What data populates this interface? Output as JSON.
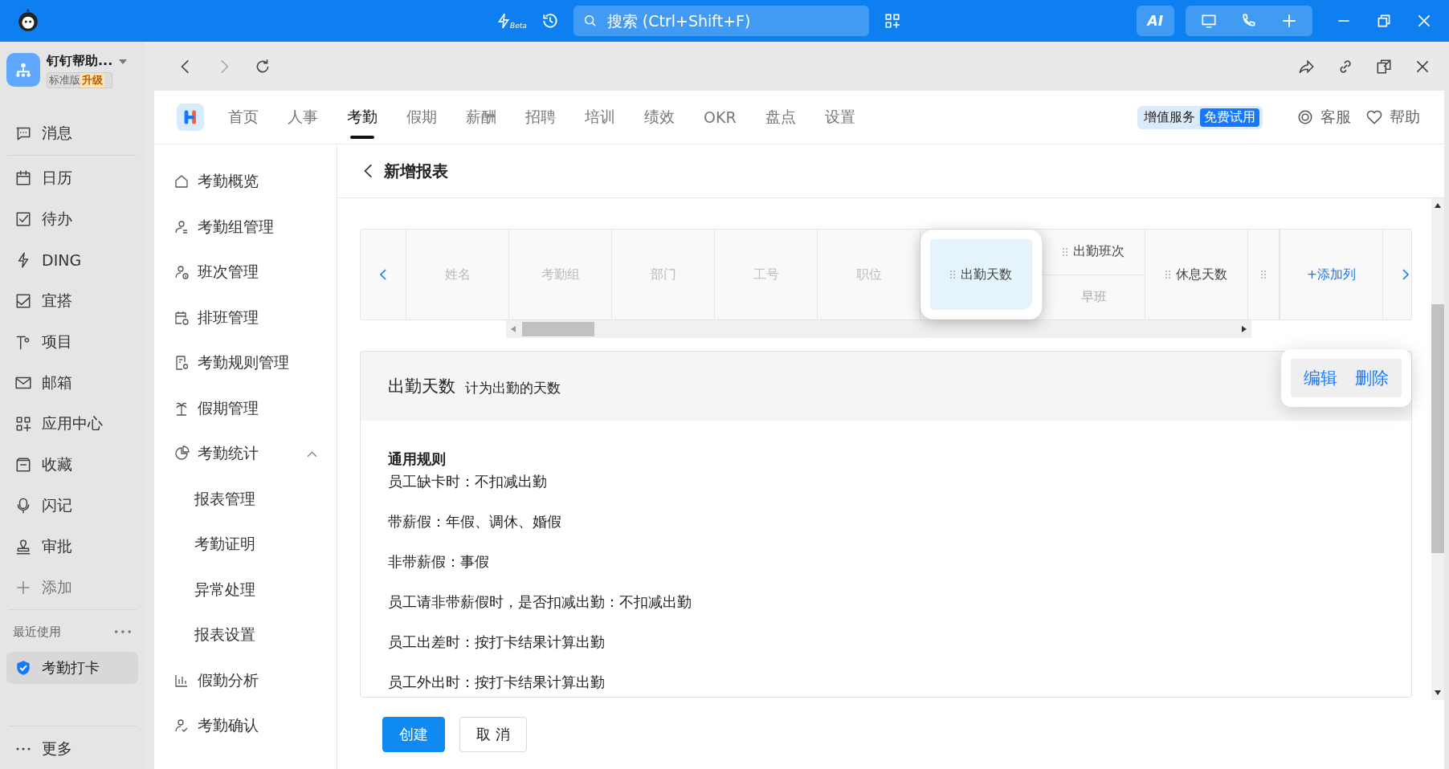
{
  "titlebar": {
    "beta_label": "Beta",
    "search_placeholder": "搜索 (Ctrl+Shift+F)",
    "ai_label": "AI"
  },
  "org": {
    "name": "钉钉帮助...",
    "edition": "标准版",
    "upgrade": "升级"
  },
  "sidebar": {
    "items": [
      {
        "label": "消息",
        "kind": "nav"
      },
      {
        "label": "日历",
        "kind": "nav"
      },
      {
        "label": "待办",
        "kind": "nav"
      },
      {
        "label": "DING",
        "kind": "nav"
      },
      {
        "label": "宜搭",
        "kind": "nav"
      },
      {
        "label": "项目",
        "kind": "nav"
      },
      {
        "label": "邮箱",
        "kind": "nav"
      },
      {
        "label": "应用中心",
        "kind": "nav"
      },
      {
        "label": "收藏",
        "kind": "nav"
      },
      {
        "label": "闪记",
        "kind": "nav"
      },
      {
        "label": "审批",
        "kind": "nav"
      },
      {
        "label": "添加",
        "kind": "add"
      }
    ],
    "recent_label": "最近使用",
    "recent": [
      {
        "label": "考勤打卡",
        "selected": true
      }
    ],
    "more": "更多"
  },
  "app_nav": {
    "tabs": [
      {
        "label": "首页",
        "selected": false
      },
      {
        "label": "人事",
        "selected": false
      },
      {
        "label": "考勤",
        "selected": true
      },
      {
        "label": "假期",
        "selected": false
      },
      {
        "label": "薪酬",
        "selected": false
      },
      {
        "label": "招聘",
        "selected": false
      },
      {
        "label": "培训",
        "selected": false
      },
      {
        "label": "绩效",
        "selected": false
      },
      {
        "label": "OKR",
        "selected": false
      },
      {
        "label": "盘点",
        "selected": false
      },
      {
        "label": "设置",
        "selected": false
      }
    ],
    "value_service": "增值服务",
    "free_trial": "免费试用",
    "support": "客服",
    "help": "帮助"
  },
  "menu": [
    {
      "label": "考勤概览"
    },
    {
      "label": "考勤组管理"
    },
    {
      "label": "班次管理"
    },
    {
      "label": "排班管理"
    },
    {
      "label": "考勤规则管理"
    },
    {
      "label": "假期管理"
    },
    {
      "label": "考勤统计",
      "expanded": true,
      "children": [
        {
          "label": "报表管理"
        },
        {
          "label": "考勤证明"
        },
        {
          "label": "异常处理"
        },
        {
          "label": "报表设置"
        }
      ]
    },
    {
      "label": "假勤分析"
    },
    {
      "label": "考勤确认"
    }
  ],
  "page_title": "新增报表",
  "columns": [
    {
      "label": "姓名",
      "kind": "fixed",
      "selected": false
    },
    {
      "label": "考勤组",
      "kind": "fixed",
      "selected": false
    },
    {
      "label": "部门",
      "kind": "fixed",
      "selected": false
    },
    {
      "label": "工号",
      "kind": "fixed",
      "selected": false
    },
    {
      "label": "职位",
      "kind": "fixed",
      "selected": false
    },
    {
      "label": "出勤天数",
      "kind": "custom",
      "selected": true
    },
    {
      "label": "出勤班次",
      "kind": "custom",
      "selected": false,
      "sub": "早班"
    },
    {
      "label": "休息天数",
      "kind": "custom",
      "selected": false
    },
    {
      "kind": "cut"
    }
  ],
  "add_column": "+添加列",
  "detail": {
    "title": "出勤天数",
    "subtitle": "计为出勤的天数",
    "actions": [
      "编辑",
      "删除"
    ],
    "section": "通用规则",
    "rules": [
      "员工缺卡时：不扣减出勤",
      "带薪假：年假、调休、婚假",
      "非带薪假：事假",
      "员工请非带薪假时，是否扣减出勤：不扣减出勤",
      "员工出差时：按打卡结果计算出勤",
      "员工外出时：按打卡结果计算出勤"
    ]
  },
  "buttons": [
    {
      "label": "创建",
      "kind": "primary"
    },
    {
      "label": "取 消",
      "kind": "default"
    }
  ]
}
